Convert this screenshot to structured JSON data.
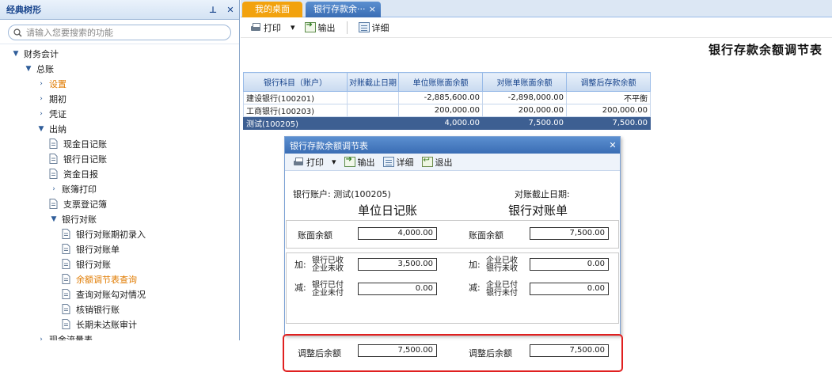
{
  "left_panel": {
    "title": "经典树形",
    "pin_glyph": "⊥",
    "close_glyph": "✕",
    "search_placeholder": "请输入您要搜索的功能",
    "tree": [
      {
        "label": "财务会计",
        "arrow": "▼",
        "type": "folder",
        "indent": 0
      },
      {
        "label": "总账",
        "arrow": "▼",
        "type": "folder",
        "indent": 1
      },
      {
        "label": "设置",
        "arrow": "›",
        "type": "folder",
        "indent": 2,
        "orange": true
      },
      {
        "label": "期初",
        "arrow": "›",
        "type": "folder",
        "indent": 2
      },
      {
        "label": "凭证",
        "arrow": "›",
        "type": "folder",
        "indent": 2
      },
      {
        "label": "出纳",
        "arrow": "▼",
        "type": "folder",
        "indent": 2
      },
      {
        "label": "现金日记账",
        "type": "doc",
        "indent": 3
      },
      {
        "label": "银行日记账",
        "type": "doc",
        "indent": 3
      },
      {
        "label": "资金日报",
        "type": "doc",
        "indent": 3
      },
      {
        "label": "账簿打印",
        "arrow": "›",
        "type": "folder",
        "indent": 3
      },
      {
        "label": "支票登记簿",
        "type": "doc",
        "indent": 3
      },
      {
        "label": "银行对账",
        "arrow": "▼",
        "type": "folder",
        "indent": 3
      },
      {
        "label": "银行对账期初录入",
        "type": "doc",
        "indent": 4
      },
      {
        "label": "银行对账单",
        "type": "doc",
        "indent": 4
      },
      {
        "label": "银行对账",
        "type": "doc",
        "indent": 4
      },
      {
        "label": "余额调节表查询",
        "type": "doc",
        "indent": 4,
        "orange": true
      },
      {
        "label": "查询对账勾对情况",
        "type": "doc",
        "indent": 4
      },
      {
        "label": "核销银行账",
        "type": "doc",
        "indent": 4
      },
      {
        "label": "长期未达账审计",
        "type": "doc",
        "indent": 4
      },
      {
        "label": "现金流量表",
        "arrow": "›",
        "type": "folder",
        "indent": 2
      }
    ]
  },
  "tabs": {
    "home": "我的桌面",
    "active": "银行存款余···",
    "close_glyph": "×"
  },
  "toolbar": {
    "print": "打印",
    "dropdown": "▾",
    "export": "输出",
    "detail": "详细"
  },
  "report": {
    "title": "银行存款余额调节表",
    "columns": [
      "银行科目（账户）",
      "对账截止日期",
      "单位账账面余额",
      "对账单账面余额",
      "调整后存款余额"
    ],
    "rows": [
      {
        "account": "建设银行(100201)",
        "date": "",
        "book": "-2,885,600.00",
        "statement": "-2,898,000.00",
        "adjusted": "不平衡",
        "selected": false
      },
      {
        "account": "工商银行(100203)",
        "date": "",
        "book": "200,000.00",
        "statement": "200,000.00",
        "adjusted": "200,000.00",
        "selected": false
      },
      {
        "account": "测试(100205)",
        "date": "",
        "book": "4,000.00",
        "statement": "7,500.00",
        "adjusted": "7,500.00",
        "selected": true
      }
    ]
  },
  "dialog": {
    "title": "银行存款余额调节表",
    "close_glyph": "✕",
    "toolbar": {
      "print": "打印",
      "dropdown": "▾",
      "export": "输出",
      "detail": "详细",
      "exit": "退出"
    },
    "account_label": "银行账户:",
    "account_value": "测试(100205)",
    "cutoff_label": "对账截止日期:",
    "left_heading": "单位日记账",
    "right_heading": "银行对账单",
    "book_balance_label": "账面余额",
    "book_balance_left": "4,000.00",
    "book_balance_right": "7,500.00",
    "add_label": "加:",
    "subtract_label": "减:",
    "left_add_line1": "银行已收",
    "left_add_line2": "企业未收",
    "left_add_value": "3,500.00",
    "right_add_line1": "企业已收",
    "right_add_line2": "银行未收",
    "right_add_value": "0.00",
    "left_sub_line1": "银行已付",
    "left_sub_line2": "企业未付",
    "left_sub_value": "0.00",
    "right_sub_line1": "企业已付",
    "right_sub_line2": "银行未付",
    "right_sub_value": "0.00",
    "adjusted_label": "调整后余额",
    "adjusted_left": "7,500.00",
    "adjusted_right": "7,500.00"
  }
}
